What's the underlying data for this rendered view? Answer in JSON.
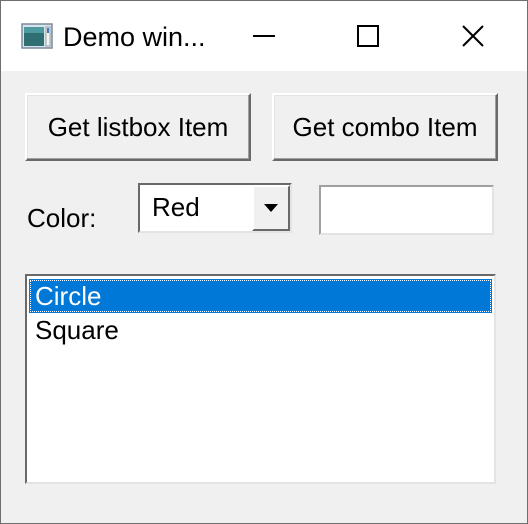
{
  "window": {
    "title": "Demo win...",
    "icon": "app-window-icon",
    "controls": {
      "minimize_icon": "minimize-icon",
      "maximize_icon": "maximize-icon",
      "close_icon": "close-icon"
    }
  },
  "buttons": {
    "get_listbox_label": "Get listbox Item",
    "get_combo_label": "Get combo Item"
  },
  "color_row": {
    "label": "Color:",
    "combo_value": "Red",
    "combo_arrow_icon": "chevron-down-icon",
    "edit_value": ""
  },
  "listbox": {
    "items": [
      {
        "label": "Circle",
        "selected": true
      },
      {
        "label": "Square",
        "selected": false
      }
    ],
    "selection_color": "#0078d7"
  }
}
